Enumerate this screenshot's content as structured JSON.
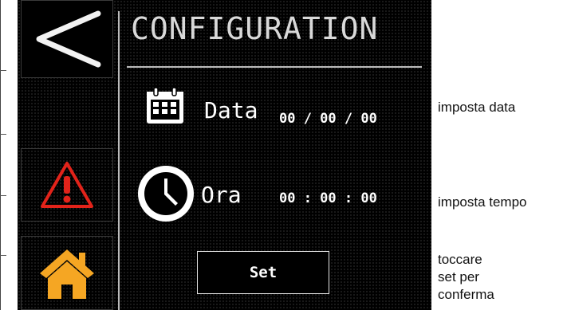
{
  "screen": {
    "title": "CONFIGURATION",
    "sidebar": [
      {
        "icon": "back-arrow-icon"
      },
      {
        "icon": "alarm-warning-icon",
        "color": "#e2231a"
      },
      {
        "icon": "home-icon",
        "color": "#f5a623"
      }
    ],
    "date_row": {
      "icon": "calendar-icon",
      "label": "Data",
      "value": "00 / 00 / 00"
    },
    "time_row": {
      "icon": "clock-icon",
      "label": "Ora",
      "value": "00 : 00 : 00"
    },
    "set_button": {
      "label": "Set"
    }
  },
  "annotations": {
    "date_note": "imposta data",
    "time_note": "imposta tempo",
    "set_note": [
      "toccare",
      "set per",
      "conferma"
    ]
  }
}
